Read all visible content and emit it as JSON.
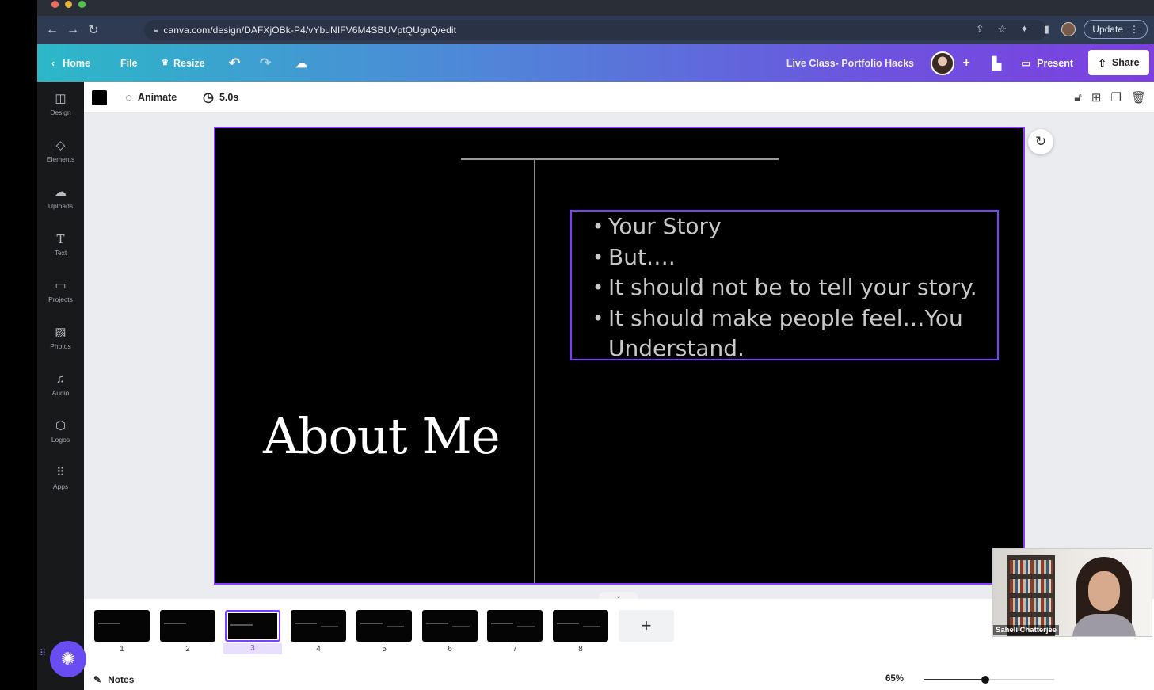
{
  "browser": {
    "url": "canva.com/design/DAFXjOBk-P4/vYbuNIFV6M4SBUVptQUgnQ/edit",
    "update_label": "Update"
  },
  "header": {
    "home_label": "Home",
    "file_label": "File",
    "resize_label": "Resize",
    "design_title": "Live Class- Portfolio Hacks",
    "present_label": "Present",
    "share_label": "Share"
  },
  "toolbar": {
    "text_color": "#000000",
    "animate_label": "Animate",
    "duration_label": "5.0s"
  },
  "sidebar": {
    "items": [
      {
        "label": "Design",
        "icon": "layout-icon"
      },
      {
        "label": "Elements",
        "icon": "shapes-icon"
      },
      {
        "label": "Uploads",
        "icon": "cloud-upload-icon"
      },
      {
        "label": "Text",
        "icon": "text-icon"
      },
      {
        "label": "Projects",
        "icon": "folder-icon"
      },
      {
        "label": "Photos",
        "icon": "image-icon"
      },
      {
        "label": "Audio",
        "icon": "music-icon"
      },
      {
        "label": "Logos",
        "icon": "logo-icon"
      },
      {
        "label": "Apps",
        "icon": "grid-icon"
      }
    ]
  },
  "slide": {
    "title": "About Me",
    "bullets": [
      "Your Story",
      "But….",
      "It should not be to tell your story.",
      "It should make people feel…You Understand."
    ],
    "accent_color": "#8b3dff"
  },
  "pages": {
    "numbers": [
      "1",
      "2",
      "3",
      "4",
      "5",
      "6",
      "7",
      "8"
    ],
    "active_index": 2,
    "add_label": "+"
  },
  "footer": {
    "notes_label": "Notes",
    "zoom_label": "65%",
    "zoom_fraction": 0.47
  },
  "webcam": {
    "name": "Saheli Chatterjee"
  }
}
